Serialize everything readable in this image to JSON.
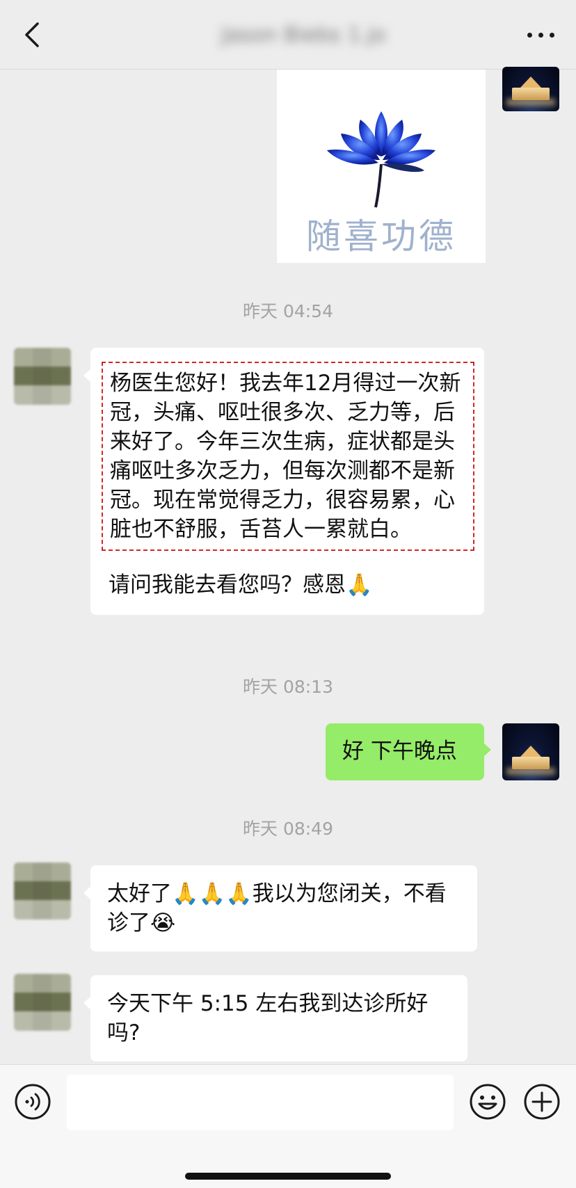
{
  "header": {
    "title": "Jason Biebs 1.jo"
  },
  "image_message": {
    "caption": "随喜功德"
  },
  "timestamps": [
    "昨天 04:54",
    "昨天 08:13",
    "昨天 08:49"
  ],
  "messages": [
    {
      "from": "other",
      "highlighted_text": "杨医生您好！我去年12月得过一次新冠，头痛、呕吐很多次、乏力等，后来好了。今年三次生病，症状都是头痛呕吐多次乏力，但每次测都不是新冠。现在常觉得乏力，很容易累，心脏也不舒服，舌苔人一累就白。",
      "text": "请问我能去看您吗？感恩🙏"
    },
    {
      "from": "me",
      "text": "好 下午晚点"
    },
    {
      "from": "other",
      "text": "太好了🙏🙏🙏我以为您闭关，不看诊了😭"
    },
    {
      "from": "other",
      "text": "今天下午 5:15 左右我到达诊所好吗?"
    }
  ],
  "colors": {
    "background": "#ededed",
    "my_bubble": "#95ec69",
    "their_bubble": "#ffffff",
    "highlight_border": "#d0262b"
  },
  "icons": [
    "back-icon",
    "more-icon",
    "voice-icon",
    "emoji-icon",
    "plus-icon"
  ]
}
